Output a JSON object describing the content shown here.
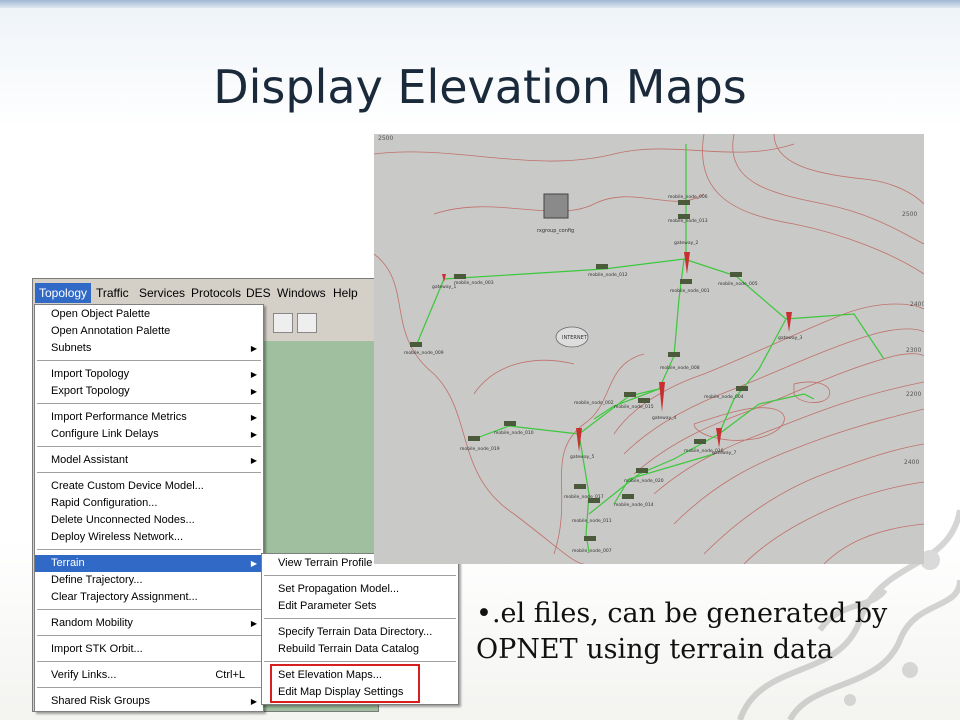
{
  "slide": {
    "title": "Display Elevation Maps"
  },
  "menubar": {
    "items": [
      "Topology",
      "Traffic",
      "Services",
      "Protocols",
      "DES",
      "Windows",
      "Help"
    ]
  },
  "topology_menu": {
    "items": [
      {
        "label": "Open Object Palette"
      },
      {
        "label": "Open Annotation Palette"
      },
      {
        "label": "Subnets",
        "submenu": true
      },
      {
        "label": "Import Topology",
        "submenu": true
      },
      {
        "label": "Export Topology",
        "submenu": true
      },
      {
        "label": "Import Performance Metrics",
        "submenu": true
      },
      {
        "label": "Configure Link Delays",
        "submenu": true
      },
      {
        "label": "Model Assistant",
        "submenu": true
      },
      {
        "label": "Create Custom Device Model..."
      },
      {
        "label": "Rapid Configuration..."
      },
      {
        "label": "Delete Unconnected Nodes..."
      },
      {
        "label": "Deploy Wireless Network..."
      },
      {
        "label": "Terrain",
        "submenu": true,
        "highlighted": true
      },
      {
        "label": "Define Trajectory..."
      },
      {
        "label": "Clear Trajectory Assignment..."
      },
      {
        "label": "Random Mobility",
        "submenu": true
      },
      {
        "label": "Import STK Orbit..."
      },
      {
        "label": "Verify Links...",
        "shortcut": "Ctrl+L"
      },
      {
        "label": "Shared Risk Groups",
        "submenu": true
      }
    ]
  },
  "terrain_menu": {
    "items": [
      {
        "label": "View Terrain Profile"
      },
      {
        "label": "Set Propagation Model..."
      },
      {
        "label": "Edit Parameter Sets"
      },
      {
        "label": "Specify Terrain Data Directory..."
      },
      {
        "label": "Rebuild Terrain Data Catalog"
      },
      {
        "label": "Set Elevation Maps..."
      },
      {
        "label": "Edit Map Display Settings"
      }
    ],
    "highlight_color": "#d62020"
  },
  "map": {
    "contour_labels": [
      "2500",
      "2500",
      "2400",
      "2300",
      "2200",
      "2400"
    ],
    "internet_label": "INTERNET",
    "config_label": "rxgroup_config",
    "gateways": [
      "gateway_1",
      "gateway_2",
      "gateway_3",
      "gateway_4",
      "gateway_5",
      "gateway_7"
    ],
    "nodes": [
      "mobile_node_006",
      "mobile_node_013",
      "mobile_node_003",
      "mobile_node_012",
      "mobile_node_001",
      "mobile_node_005",
      "mobile_node_009",
      "mobile_node_008",
      "mobile_node_002",
      "mobile_node_015",
      "mobile_node_004",
      "mobile_node_010",
      "mobile_node_019",
      "mobile_node_011",
      "mobile_node_016",
      "mobile_node_020",
      "mobile_node_017",
      "mobile_node_014",
      "mobile_node_007"
    ],
    "colors": {
      "background": "#c9c9c7",
      "contour": "#c0706a",
      "link": "#3cc83c",
      "tower": "#c83030"
    }
  },
  "caption": {
    "bullet": "•",
    "text": ".el files, can be generated by OPNET using terrain data"
  }
}
